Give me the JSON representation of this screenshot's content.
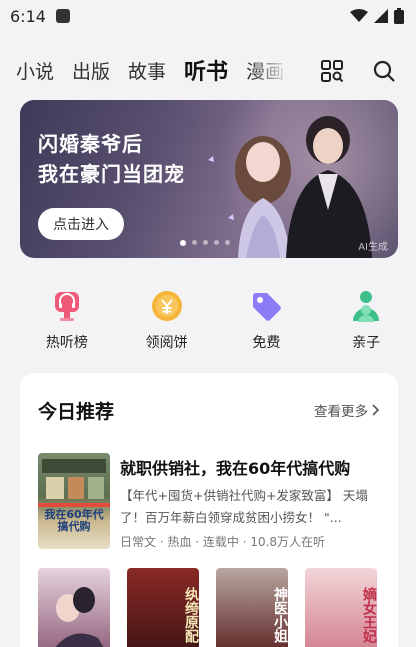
{
  "status_bar": {
    "time": "6:14"
  },
  "nav": {
    "tabs": [
      {
        "label": "小说",
        "active": false
      },
      {
        "label": "出版",
        "active": false
      },
      {
        "label": "故事",
        "active": false
      },
      {
        "label": "听书",
        "active": true
      },
      {
        "label": "漫画",
        "active": false
      }
    ],
    "icons": [
      "grid-search-icon",
      "search-icon"
    ]
  },
  "banner": {
    "line1": "闪婚秦爷后",
    "line2": "我在豪门当团宠",
    "button": "点击进入",
    "ai_mark": "AI生成",
    "slide_count": 5,
    "active_slide": 1
  },
  "quick_entries": [
    {
      "label": "热听榜",
      "icon": "headphones-trophy-icon",
      "color": "#ef5a7a"
    },
    {
      "label": "领阅饼",
      "icon": "coin-icon",
      "color": "#f5b53a"
    },
    {
      "label": "免费",
      "icon": "tag-icon",
      "color": "#8b7cf6"
    },
    {
      "label": "亲子",
      "icon": "parent-child-icon",
      "color": "#3cbf8a"
    }
  ],
  "recommend": {
    "title": "今日推荐",
    "see_more": "查看更多",
    "featured": {
      "title": "就职供销社，我在60年代搞代购",
      "description": "【年代+囤货+供销社代购+发家致富】 天塌了！百万年薪白领穿成贫困小捞女！ \"...",
      "meta": "日常文 · 热血 · 连载中 · 10.8万人在听",
      "cover_text": "我在60年代搞代购"
    },
    "covers": [
      {
        "title": "",
        "color_top": "#e6d2dc",
        "color_bottom": "#8c5a76"
      },
      {
        "title": "纨绔原配",
        "color_top": "#8a2a25",
        "color_bottom": "#3a1414"
      },
      {
        "title": "神医小姐",
        "color_top": "#b8a6a0",
        "color_bottom": "#5a2020"
      },
      {
        "title": "嫡女王妃",
        "color_top": "#f3d5d8",
        "color_bottom": "#d07a8a"
      }
    ]
  }
}
